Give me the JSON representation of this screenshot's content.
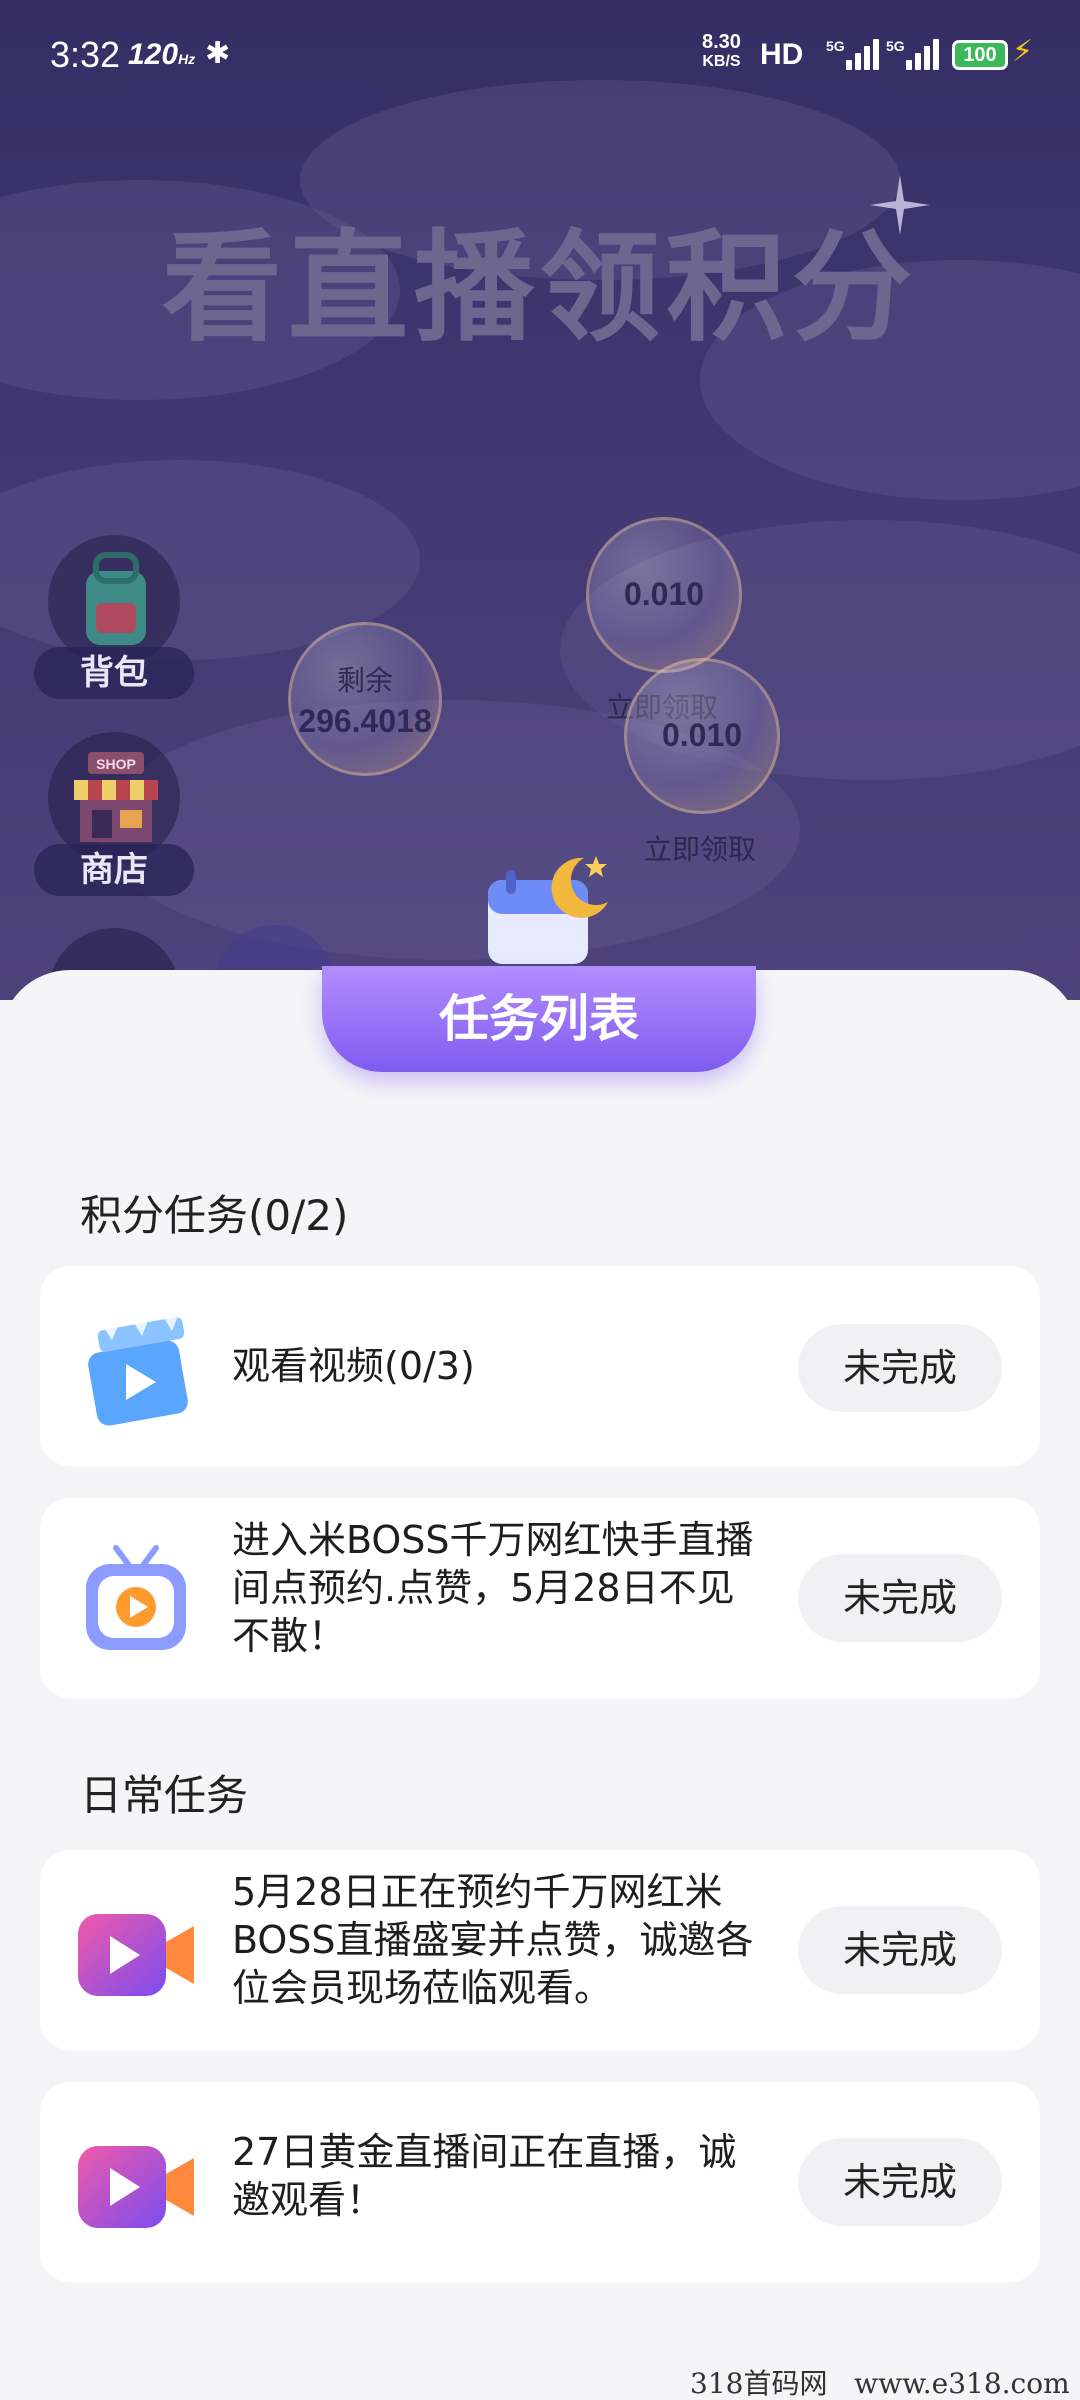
{
  "status_bar": {
    "time": "3:32",
    "refresh_rate": "120",
    "refresh_unit": "Hz",
    "net_speed_value": "8.30",
    "net_speed_unit": "KB/S",
    "hd_label": "HD",
    "network_label": "5G",
    "battery": "100"
  },
  "hero": {
    "title": "看直播领积分",
    "side_buttons": [
      {
        "label": "背包",
        "icon": "backpack-icon"
      },
      {
        "label": "商店",
        "icon": "shop-icon",
        "sign": "SHOP"
      }
    ],
    "balance": {
      "label": "剩余",
      "value": "296.4018"
    },
    "bubbles": [
      {
        "value": "0.010",
        "caption": "立即领取"
      },
      {
        "value": "0.010",
        "caption": "立即领取"
      }
    ]
  },
  "task_list": {
    "title": "任务列表",
    "sections": [
      {
        "title": "积分任务(0/2)",
        "tasks": [
          {
            "text": "观看视频(0/3)",
            "icon": "video-clapper-icon",
            "status": "未完成"
          },
          {
            "text": "进入米BOSS千万网红快手直播间点预约.点赞，5月28日不见不散！",
            "icon": "tv-play-icon",
            "status": "未完成"
          }
        ]
      },
      {
        "title": "日常任务",
        "tasks": [
          {
            "text": "5月28日正在预约千万网红米BOSS直播盛宴并点赞，诚邀各位会员现场莅临观看。",
            "icon": "video-camera-icon",
            "status": "未完成"
          },
          {
            "text": "27日黄金直播间正在直播，诚邀观看！",
            "icon": "video-camera-icon",
            "status": "未完成"
          }
        ]
      }
    ]
  },
  "watermark": "318首码网   www.e318.com",
  "colors": {
    "accent": "#8a66f5",
    "hero_bg": "#433b78",
    "sheet_bg": "#f5f5f7"
  }
}
